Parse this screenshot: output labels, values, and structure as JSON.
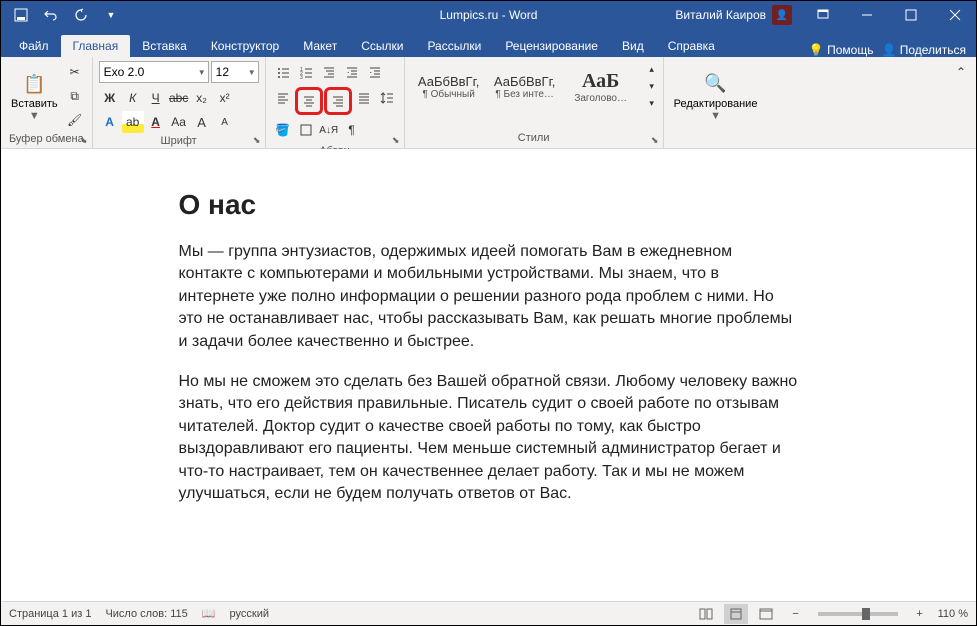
{
  "titlebar": {
    "title": "Lumpics.ru - Word",
    "user": "Виталий Каиров"
  },
  "tabs": {
    "file": "Файл",
    "home": "Главная",
    "insert": "Вставка",
    "design": "Конструктор",
    "layout": "Макет",
    "references": "Ссылки",
    "mailings": "Рассылки",
    "review": "Рецензирование",
    "view": "Вид",
    "help": "Справка",
    "tellme": "Помощь",
    "share": "Поделиться"
  },
  "ribbon": {
    "clipboard": {
      "label": "Буфер обмена",
      "paste": "Вставить"
    },
    "font": {
      "label": "Шрифт",
      "name": "Exo 2.0",
      "size": "12",
      "bold": "Ж",
      "italic": "К",
      "underline": "Ч",
      "strike": "abc",
      "sub": "x₂",
      "sup": "x²",
      "effects": "A",
      "highlight": "⚡",
      "fontcolor": "A",
      "case": "Aa",
      "grow": "A↑",
      "shrink": "A↓"
    },
    "paragraph": {
      "label": "Абзац"
    },
    "styles": {
      "label": "Стили",
      "items": [
        {
          "preview": "АаБбВвГг,",
          "name": "¶ Обычный"
        },
        {
          "preview": "АаБбВвГг,",
          "name": "¶ Без инте…"
        },
        {
          "preview": "АаБ",
          "name": "Заголово…"
        }
      ]
    },
    "editing": {
      "label": "Редактирование"
    }
  },
  "doc": {
    "h": "О нас",
    "p1": "Мы — группа энтузиастов, одержимых идеей помогать Вам в ежедневном контакте с компьютерами и мобильными устройствами. Мы знаем, что в интернете уже полно информации о решении разного рода проблем с ними. Но это не останавливает нас, чтобы рассказывать Вам, как решать многие проблемы и задачи более качественно и быстрее.",
    "p2": "Но мы не сможем это сделать без Вашей обратной связи. Любому человеку важно знать, что его действия правильные. Писатель судит о своей работе по отзывам читателей. Доктор судит о качестве своей работы по тому, как быстро выздоравливают его пациенты. Чем меньше системный администратор бегает и что-то настраивает, тем он качественнее делает работу. Так и мы не можем улучшаться, если не будем получать ответов от Вас."
  },
  "status": {
    "page": "Страница 1 из 1",
    "words": "Число слов: 115",
    "lang": "русский",
    "zoom": "110 %"
  }
}
